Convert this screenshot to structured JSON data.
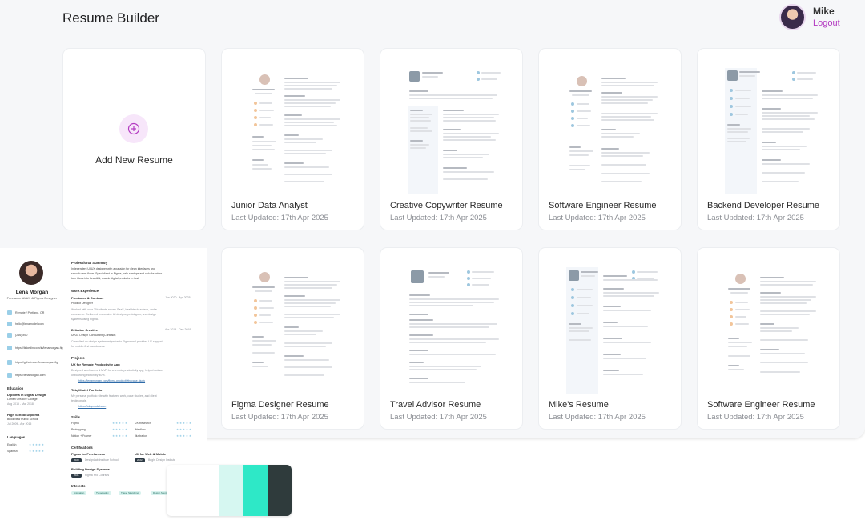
{
  "app": {
    "title": "Resume Builder"
  },
  "user": {
    "name": "Mike",
    "logout": "Logout"
  },
  "add_card": {
    "label": "Add New Resume"
  },
  "resumes": [
    {
      "title": "Junior Data Analyst",
      "updated": "Last Updated: 17th Apr 2025"
    },
    {
      "title": "Creative Copywriter Resume",
      "updated": "Last Updated: 17th Apr 2025"
    },
    {
      "title": "Software Engineer Resume",
      "updated": "Last Updated: 17th Apr 2025"
    },
    {
      "title": "Backend Developer Resume",
      "updated": "Last Updated: 17th Apr 2025"
    },
    {
      "title": "Figma Designer Resume",
      "updated": "Last Updated: 17th Apr 2025"
    },
    {
      "title": "Travel Advisor Resume",
      "updated": "Last Updated: 17th Apr 2025"
    },
    {
      "title": "Mike's Resume",
      "updated": "Last Updated: 17th Apr 2025"
    },
    {
      "title": "Software Engineer Resume",
      "updated": "Last Updated: 17th Apr 2025"
    }
  ],
  "preview": {
    "name": "Lena Morgan",
    "role": "Freelance UI/UX & Figma Designer",
    "contact": [
      "Remote / Portland, OR",
      "hello@lenamodel.com",
      "(266) 890",
      "https://linkedin.com/in/lenamorgan-fig",
      "https://github.com/lenamorgan-fig",
      "https://lenamorgan.com"
    ],
    "education_heading": "Education",
    "education": [
      {
        "degree": "Diploma in Digital Design",
        "school": "Lumen Creative College",
        "dates": "Aug 2015 - Mar 2018"
      },
      {
        "degree": "High School Diploma",
        "school": "Brookview Public School",
        "dates": "Jul 2009 - Apr 2015"
      }
    ],
    "languages_heading": "Languages",
    "languages": [
      "English",
      "Spanish"
    ],
    "summary_heading": "Professional Summary",
    "summary": [
      "Independent UI/UX designer with a passion for clean interfaces and",
      "smooth user flows. Specialized in Figma, help startups and solo founders",
      "turn ideas into beautiful, usable digital products — fast."
    ],
    "work_heading": "Work Experience",
    "work": [
      {
        "company": "Freelance & Contract",
        "role": "Product Designer",
        "dates": "Jan 2020 - Apr 2025",
        "desc": [
          "Worked with over 30+ clients across SaaS, healthtech, edtech, and e-",
          "commerce. Delivered responsive UI designs, prototypes, and design",
          "systems using Figma."
        ]
      },
      {
        "company": "Dribbble Creative",
        "role": "UI/UX Design Consultant (Contract)",
        "dates": "Apr 2019 - Dec 2019",
        "desc": [
          "Consulted on design system migration to Figma and provided UX support",
          "for mobile-first dashboards."
        ]
      }
    ],
    "projects_heading": "Projects",
    "projects": [
      {
        "name": "UX for Remote Productivity App",
        "desc": [
          "Designed wireframes & MVP for a remote productivity app, helped reduce",
          "onboarding friction by 40%."
        ],
        "link": "https://lenamorgan.com/figma-productivity-case-study"
      },
      {
        "name": "TobyModel Portfolio",
        "desc": [
          "My personal portfolio site with featured work, case studies, and client",
          "testimonials."
        ],
        "link": "https://tobymodel.com"
      }
    ],
    "skills_heading": "Skills",
    "skills": [
      "Figma",
      "UX Research",
      "Prototyping",
      "Webflow",
      "Notion + Framer",
      "Illustration"
    ],
    "certifications_heading": "Certifications",
    "certifications": [
      {
        "name": "Figma for Freelancers",
        "year": "2023",
        "issuer": "DesignLab Institute School"
      },
      {
        "name": "UX for Web & Mobile",
        "year": "2022",
        "issuer": "Bright Design Institute"
      },
      {
        "name": "Building Design Systems",
        "year": "2021",
        "issuer": "Figma Pro Courses"
      }
    ],
    "interests_heading": "Interests",
    "interests": [
      "Animation",
      "Typography",
      "Travel Sketching",
      "Design Mentoring"
    ]
  },
  "palette": [
    "#ffffff",
    "#d6f7f1",
    "#2ee8c7",
    "#2f3b3c"
  ],
  "colors": {
    "accent": "#b33ac1",
    "panel_bg": "#f6f7f9"
  }
}
